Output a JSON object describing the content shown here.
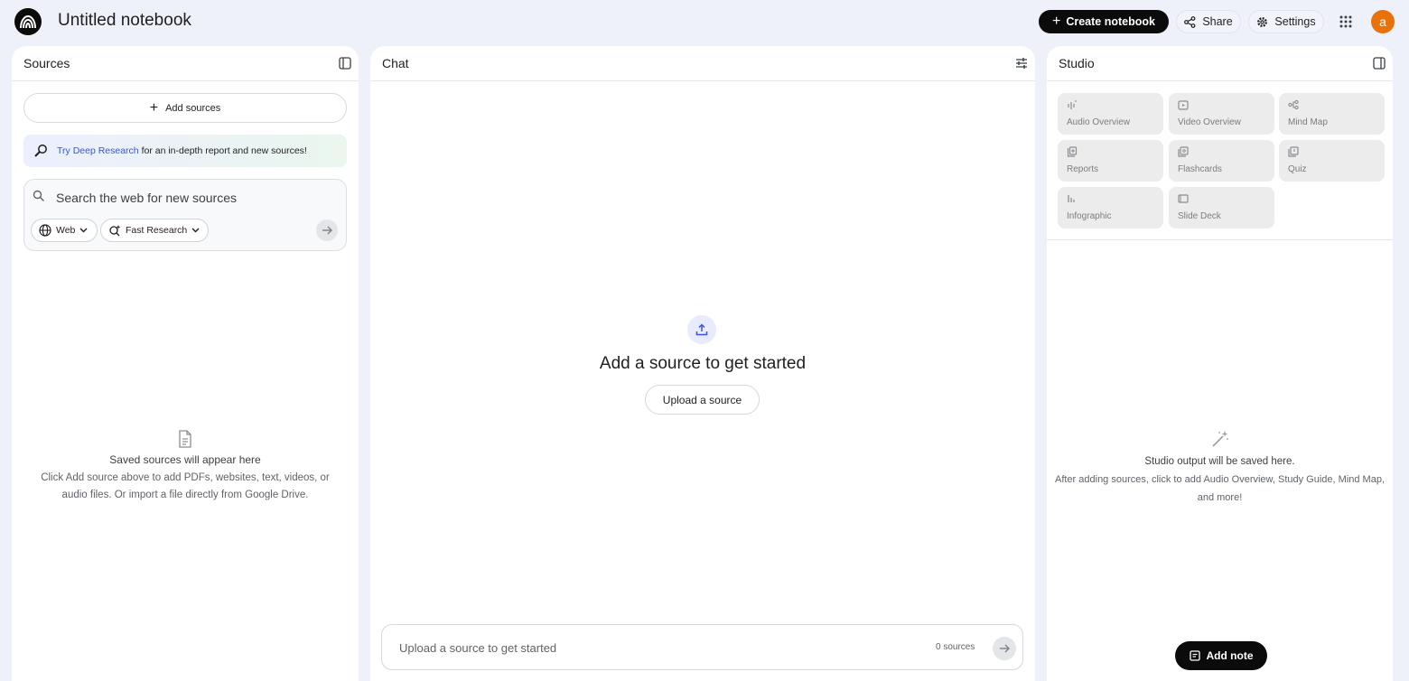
{
  "header": {
    "notebook_title": "Untitled notebook",
    "create_label": "Create notebook",
    "share_label": "Share",
    "settings_label": "Settings",
    "avatar_letter": "a",
    "avatar_color": "#e8710a"
  },
  "sources": {
    "title": "Sources",
    "add_sources_label": "Add sources",
    "deep_research_link": "Try Deep Research",
    "deep_research_text": " for an in-depth report and new sources!",
    "search_placeholder": "Search the web for new sources",
    "chip_web": "Web",
    "chip_fast": "Fast Research",
    "empty_title": "Saved sources will appear here",
    "empty_desc": "Click Add source above to add PDFs, websites, text, videos, or audio files. Or import a file directly from Google Drive."
  },
  "chat": {
    "title": "Chat",
    "empty_title": "Add a source to get started",
    "upload_label": "Upload a source",
    "input_placeholder": "Upload a source to get started",
    "source_count": "0 sources"
  },
  "studio": {
    "title": "Studio",
    "tiles": [
      {
        "label": "Audio Overview",
        "icon": "audio-overview-icon"
      },
      {
        "label": "Video Overview",
        "icon": "video-overview-icon"
      },
      {
        "label": "Mind Map",
        "icon": "mind-map-icon"
      },
      {
        "label": "Reports",
        "icon": "reports-icon"
      },
      {
        "label": "Flashcards",
        "icon": "flashcards-icon"
      },
      {
        "label": "Quiz",
        "icon": "quiz-icon"
      },
      {
        "label": "Infographic",
        "icon": "infographic-icon"
      },
      {
        "label": "Slide Deck",
        "icon": "slide-deck-icon"
      }
    ],
    "empty_title": "Studio output will be saved here.",
    "empty_desc": "After adding sources, click to add Audio Overview, Study Guide, Mind Map, and more!",
    "add_note_label": "Add note"
  },
  "colors": {
    "background": "#eef0fa",
    "accent_link": "#3a55d8",
    "primary_button": "#0b0b0b"
  }
}
